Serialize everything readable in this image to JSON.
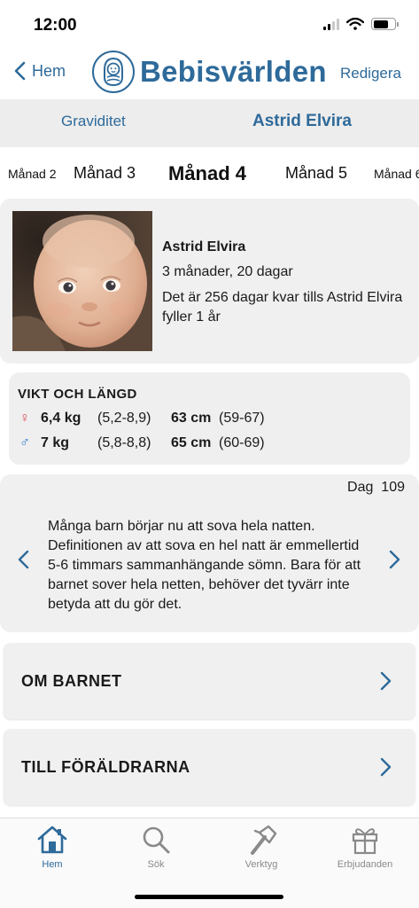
{
  "status_bar": {
    "time": "12:00"
  },
  "nav": {
    "back_label": "Hem",
    "app_title": "Bebisvärlden",
    "edit_label": "Redigera"
  },
  "segments": [
    {
      "label": "Graviditet"
    },
    {
      "label": "Astrid Elvira",
      "active": true
    }
  ],
  "months": [
    {
      "label": "Månad 2"
    },
    {
      "label": "Månad 3"
    },
    {
      "label": "Månad 4",
      "active": true
    },
    {
      "label": "Månad 5"
    },
    {
      "label": "Månad 6"
    }
  ],
  "profile": {
    "name": "Astrid Elvira",
    "age": "3 månader, 20 dagar",
    "countdown": "Det är 256 dagar kvar tills Astrid Elvira fyller 1 år"
  },
  "weight_length": {
    "title": "VIKT OCH LÄNGD",
    "rows": [
      {
        "symbol": "♀",
        "weight": "6,4 kg",
        "weight_range": "(5,2-8,9)",
        "length": "63 cm",
        "length_range": "(59-67)"
      },
      {
        "symbol": "♂",
        "weight": "7 kg",
        "weight_range": "(5,8-8,8)",
        "length": "65 cm",
        "length_range": "(60-69)"
      }
    ]
  },
  "tip": {
    "day_label": "Dag",
    "day_number": "109",
    "text": "Många barn börjar nu att sova hela natten. Definitionen av att sova en hel natt är emmellertid 5-6 timmars sammanhängande sömn. Bara för att barnet sover hela netten, behöver det tyvärr inte betyda att du gör det."
  },
  "sections": [
    {
      "label": "OM BARNET"
    },
    {
      "label": "TILL FÖRÄLDRARNA"
    }
  ],
  "tabbar": [
    {
      "label": "Hem",
      "icon": "home-icon",
      "active": true
    },
    {
      "label": "Sök",
      "icon": "search-icon"
    },
    {
      "label": "Verktyg",
      "icon": "hammer-icon"
    },
    {
      "label": "Erbjudanden",
      "icon": "gift-icon"
    }
  ],
  "colors": {
    "accent": "#2e6a9a",
    "card_bg": "#f0f0f0",
    "segment_bg": "#ededed",
    "female": "#d94a5a",
    "male": "#2e7ad0"
  }
}
